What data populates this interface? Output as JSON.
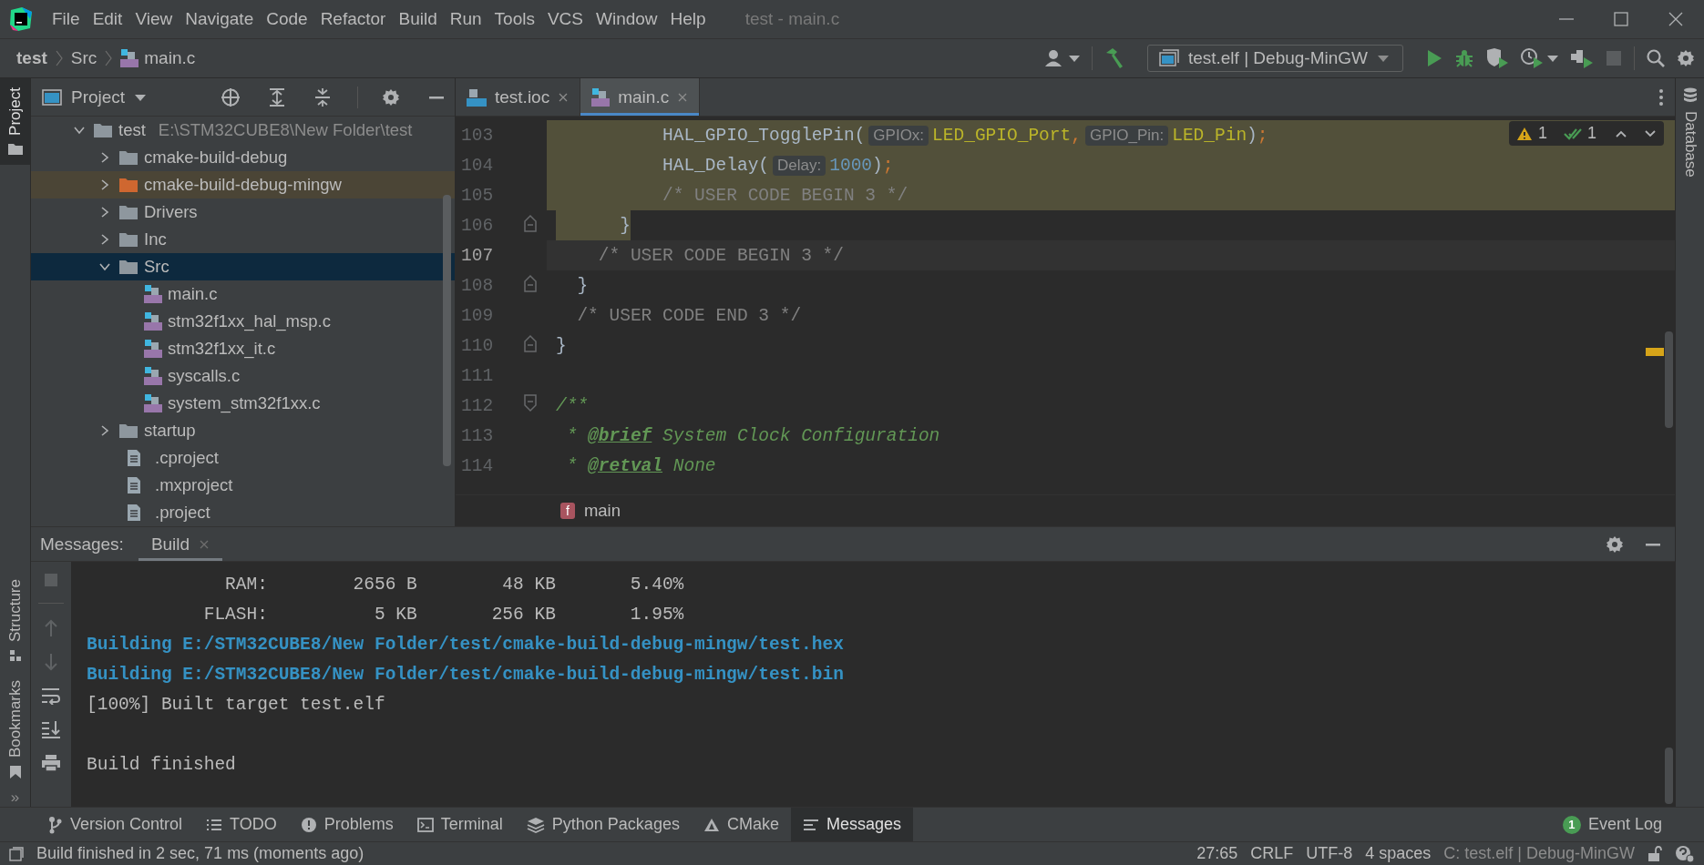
{
  "title_bar": {
    "menu": [
      "File",
      "Edit",
      "View",
      "Navigate",
      "Code",
      "Refactor",
      "Build",
      "Run",
      "Tools",
      "VCS",
      "Window",
      "Help"
    ],
    "title": "test - main.c"
  },
  "nav_bar": {
    "breadcrumbs": [
      "test",
      "Src",
      "main.c"
    ],
    "run_config": "test.elf | Debug-MinGW"
  },
  "left_stripe": {
    "top": [
      {
        "label": "Project",
        "selected": true
      }
    ],
    "bottom": [
      {
        "label": "Structure",
        "selected": false
      },
      {
        "label": "Bookmarks",
        "selected": false
      }
    ]
  },
  "project": {
    "title": "Project",
    "tree": [
      {
        "label": "test",
        "path": "E:\\STM32CUBE8\\New Folder\\test",
        "kind": "folder",
        "expanded": true,
        "selected": false,
        "children": [
          {
            "label": "cmake-build-debug",
            "kind": "folder",
            "expanded": false,
            "selected": false
          },
          {
            "label": "cmake-build-debug-mingw",
            "kind": "excluded-folder",
            "expanded": false,
            "selected": false
          },
          {
            "label": "Drivers",
            "kind": "folder",
            "expanded": false,
            "selected": false
          },
          {
            "label": "Inc",
            "kind": "folder",
            "expanded": false,
            "selected": false
          },
          {
            "label": "Src",
            "kind": "folder",
            "expanded": true,
            "selected": true,
            "children": [
              {
                "label": "main.c",
                "kind": "c-file",
                "selected": false
              },
              {
                "label": "stm32f1xx_hal_msp.c",
                "kind": "c-file",
                "selected": false
              },
              {
                "label": "stm32f1xx_it.c",
                "kind": "c-file",
                "selected": false
              },
              {
                "label": "syscalls.c",
                "kind": "c-file",
                "selected": false
              },
              {
                "label": "system_stm32f1xx.c",
                "kind": "c-file",
                "selected": false
              }
            ]
          },
          {
            "label": "startup",
            "kind": "folder",
            "expanded": false,
            "selected": false
          },
          {
            "label": ".cproject",
            "kind": "file",
            "selected": false
          },
          {
            "label": ".mxproject",
            "kind": "file",
            "selected": false
          },
          {
            "label": ".project",
            "kind": "file",
            "selected": false
          }
        ]
      }
    ]
  },
  "editor": {
    "tabs": [
      {
        "label": "test.ioc",
        "kind": "ioc",
        "selected": false
      },
      {
        "label": "main.c",
        "kind": "c",
        "selected": true
      }
    ],
    "inspections": {
      "warnings": "1",
      "passed": "1"
    },
    "lines": [
      {
        "number": "103",
        "in_selection": true,
        "selection_end": false,
        "fold_open": false,
        "fold_close": false,
        "current": false,
        "tokens": [
          {
            "text": "          HAL_GPIO_TogglePin(",
            "kind": "plain"
          },
          {
            "text": "GPIOx:",
            "kind": "hint"
          },
          {
            "text": "LED_GPIO_Port",
            "kind": "macro"
          },
          {
            "text": ",",
            "kind": "punct"
          },
          {
            "text": "GPIO_Pin:",
            "kind": "hint"
          },
          {
            "text": "LED_Pin",
            "kind": "macro"
          },
          {
            "text": ")",
            "kind": "plain"
          },
          {
            "text": ";",
            "kind": "punct"
          }
        ]
      },
      {
        "number": "104",
        "in_selection": true,
        "selection_end": false,
        "fold_open": false,
        "fold_close": false,
        "current": false,
        "tokens": [
          {
            "text": "          HAL_Delay(",
            "kind": "plain"
          },
          {
            "text": "Delay:",
            "kind": "hint"
          },
          {
            "text": "1000",
            "kind": "number"
          },
          {
            "text": ")",
            "kind": "plain"
          },
          {
            "text": ";",
            "kind": "punct"
          }
        ]
      },
      {
        "number": "105",
        "in_selection": true,
        "selection_end": false,
        "fold_open": false,
        "fold_close": false,
        "current": false,
        "tokens": [
          {
            "text": "          /* USER CODE BEGIN 3 */",
            "kind": "comment"
          }
        ]
      },
      {
        "number": "106",
        "in_selection": false,
        "selection_end": true,
        "fold_open": false,
        "fold_close": true,
        "current": false,
        "tokens": [
          {
            "text": "      }",
            "kind": "plain"
          }
        ]
      },
      {
        "number": "107",
        "in_selection": false,
        "selection_end": false,
        "fold_open": false,
        "fold_close": false,
        "current": true,
        "tokens": [
          {
            "text": "    /* USER CODE BEGIN 3 */",
            "kind": "comment"
          }
        ]
      },
      {
        "number": "108",
        "in_selection": false,
        "selection_end": false,
        "fold_open": false,
        "fold_close": true,
        "current": false,
        "tokens": [
          {
            "text": "  }",
            "kind": "plain"
          }
        ]
      },
      {
        "number": "109",
        "in_selection": false,
        "selection_end": false,
        "fold_open": false,
        "fold_close": false,
        "current": false,
        "tokens": [
          {
            "text": "  /* USER CODE END 3 */",
            "kind": "comment"
          }
        ]
      },
      {
        "number": "110",
        "in_selection": false,
        "selection_end": false,
        "fold_open": false,
        "fold_close": true,
        "current": false,
        "tokens": [
          {
            "text": "}",
            "kind": "plain"
          }
        ]
      },
      {
        "number": "111",
        "in_selection": false,
        "selection_end": false,
        "fold_open": false,
        "fold_close": false,
        "current": false
      },
      {
        "number": "112",
        "in_selection": false,
        "selection_end": false,
        "fold_open": true,
        "fold_close": false,
        "current": false,
        "tokens": [
          {
            "text": "/**",
            "kind": "doc"
          }
        ]
      },
      {
        "number": "113",
        "in_selection": false,
        "selection_end": false,
        "fold_open": false,
        "fold_close": false,
        "current": false,
        "tokens": [
          {
            "text": " * ",
            "kind": "doc"
          },
          {
            "text": "@brief",
            "kind": "doctag"
          },
          {
            "text": " System Clock Configuration",
            "kind": "doc"
          }
        ]
      },
      {
        "number": "114",
        "in_selection": false,
        "selection_end": false,
        "fold_open": false,
        "fold_close": false,
        "current": false,
        "tokens": [
          {
            "text": " * ",
            "kind": "doc"
          },
          {
            "text": "@retval",
            "kind": "doctag"
          },
          {
            "text": " None",
            "kind": "doc"
          }
        ]
      }
    ],
    "breadcrumb": {
      "badge": "f",
      "label": "main"
    }
  },
  "right_stripe": [
    {
      "label": "Database",
      "selected": false
    }
  ],
  "messages": {
    "title": "Messages:",
    "tabs": [
      {
        "label": "Build",
        "selected": true
      }
    ],
    "more": "»",
    "output": [
      {
        "text": "             RAM:        2656 B        48 KB       5.40%",
        "kind": "plain"
      },
      {
        "text": "           FLASH:          5 KB       256 KB       1.95%",
        "kind": "plain"
      },
      {
        "text": "Building E:/STM32CUBE8/New Folder/test/cmake-build-debug-mingw/test.hex",
        "kind": "link"
      },
      {
        "text": "Building E:/STM32CUBE8/New Folder/test/cmake-build-debug-mingw/test.bin",
        "kind": "link"
      },
      {
        "text": "[100%] Built target test.elf",
        "kind": "plain"
      },
      {
        "kind": "blank"
      },
      {
        "text": "Build finished",
        "kind": "plain"
      }
    ]
  },
  "tool_windows": [
    {
      "label": "Version Control",
      "kind": "vcs",
      "selected": false
    },
    {
      "label": "TODO",
      "kind": "todo",
      "selected": false
    },
    {
      "label": "Problems",
      "kind": "problems",
      "selected": false
    },
    {
      "label": "Terminal",
      "kind": "terminal",
      "selected": false
    },
    {
      "label": "Python Packages",
      "kind": "packages",
      "selected": false
    },
    {
      "label": "CMake",
      "kind": "cmake",
      "selected": false
    },
    {
      "label": "Messages",
      "kind": "messages",
      "selected": true
    }
  ],
  "event_log": {
    "label": "Event Log",
    "count": "1"
  },
  "status_bar": {
    "message": "Build finished in 2 sec, 71 ms (moments ago)",
    "items": [
      "27:65",
      "CRLF",
      "UTF-8",
      "4 spaces"
    ],
    "context": "C: test.elf | Debug-MinGW"
  }
}
